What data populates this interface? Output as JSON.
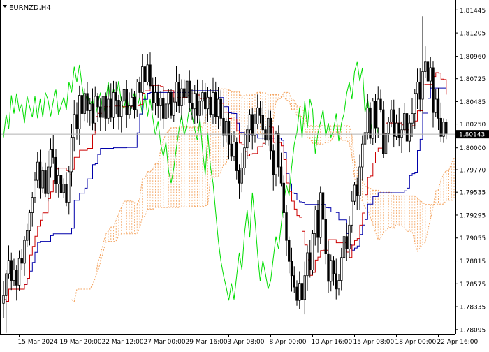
{
  "window": {
    "symbol_label": "EURNZD,H4",
    "dropdown_icon": "triangle-down-icon"
  },
  "colors": {
    "background": "#ffffff",
    "candle": "#000000",
    "tenkan": "#cc0000",
    "kijun": "#0000aa",
    "chikou": "#00dd00",
    "cloud": "#f4a460",
    "bid_line": "#b0b0b0",
    "price_tag_bg": "#000000",
    "price_tag_text": "#ffffff"
  },
  "chart_data": {
    "type": "candlestick",
    "symbol": "EURNZD",
    "timeframe": "H4",
    "ylim": [
      1.7805,
      1.8155
    ],
    "yticks": [
      "1.81445",
      "1.81205",
      "1.80960",
      "1.80725",
      "1.80485",
      "1.80250",
      "1.80000",
      "1.79770",
      "1.79535",
      "1.79295",
      "1.79055",
      "1.78815",
      "1.78575",
      "1.78335",
      "1.78095"
    ],
    "current_price": "1.80143",
    "xlabels": [
      {
        "label": "15 Mar 2024",
        "bar": 6
      },
      {
        "label": "19 Mar 20:00",
        "bar": 22
      },
      {
        "label": "22 Mar 12:00",
        "bar": 38
      },
      {
        "label": "27 Mar 00:00",
        "bar": 54
      },
      {
        "label": "29 Mar 16:00",
        "bar": 70
      },
      {
        "label": "3 Apr 08:00",
        "bar": 86
      },
      {
        "label": "8 Apr 00:00",
        "bar": 102
      },
      {
        "label": "10 Apr 16:00",
        "bar": 118
      },
      {
        "label": "15 Apr 08:00",
        "bar": 134
      },
      {
        "label": "18 Apr 00:00",
        "bar": 150
      },
      {
        "label": "22 Apr 16:00",
        "bar": 166
      }
    ],
    "close": [
      1.7845,
      1.7868,
      1.7882,
      1.7861,
      1.7872,
      1.7856,
      1.7884,
      1.7879,
      1.7903,
      1.7913,
      1.7932,
      1.7948,
      1.7966,
      1.7985,
      1.7958,
      1.7976,
      1.7952,
      1.798,
      1.7998,
      1.799,
      1.7962,
      1.7971,
      1.7953,
      1.7962,
      1.7943,
      1.7975,
      1.8011,
      1.8035,
      1.802,
      1.8055,
      1.8036,
      1.8057,
      1.8039,
      1.8046,
      1.8026,
      1.8054,
      1.8043,
      1.8032,
      1.8054,
      1.8031,
      1.8051,
      1.8032,
      1.8058,
      1.805,
      1.8033,
      1.8049,
      1.8061,
      1.8035,
      1.8044,
      1.8053,
      1.804,
      1.8069,
      1.8058,
      1.8085,
      1.8069,
      1.8087,
      1.8065,
      1.8047,
      1.8058,
      1.8044,
      1.8052,
      1.8031,
      1.8046,
      1.8058,
      1.8034,
      1.8048,
      1.8069,
      1.8044,
      1.8062,
      1.8053,
      1.807,
      1.8047,
      1.8041,
      1.8057,
      1.8034,
      1.8049,
      1.8058,
      1.8041,
      1.8053,
      1.8035,
      1.8058,
      1.8033,
      1.8051,
      1.8031,
      1.8013,
      1.8028,
      1.8004,
      1.7991,
      1.8006,
      1.7976,
      1.7963,
      1.7979,
      1.8,
      1.8019,
      1.8035,
      1.8013,
      1.8025,
      1.8042,
      1.8034,
      1.8019,
      1.8008,
      1.8031,
      1.7997,
      1.7972,
      1.8015,
      1.798,
      1.7963,
      1.7932,
      1.7903,
      1.7881,
      1.7866,
      1.7854,
      1.784,
      1.7858,
      1.7841,
      1.7866,
      1.789,
      1.7872,
      1.791,
      1.7935,
      1.7906,
      1.7953,
      1.7925,
      1.7889,
      1.786,
      1.7882,
      1.7868,
      1.7852,
      1.7861,
      1.7885,
      1.7907,
      1.7894,
      1.7919,
      1.7944,
      1.7961,
      1.795,
      1.798,
      1.8004,
      1.8016,
      1.8042,
      1.801,
      1.8049,
      1.8021,
      1.8051,
      1.804,
      1.7994,
      1.8015,
      1.8027,
      1.804,
      1.8012,
      1.8026,
      1.8011,
      1.8019,
      1.8036,
      1.8007,
      1.8026,
      1.8036,
      1.8057,
      1.8069,
      1.8051,
      1.808,
      1.809,
      1.807,
      1.8084,
      1.8037,
      1.8051,
      1.8031,
      1.8012,
      1.8027,
      1.8015
    ],
    "highs": [
      1.81,
      1.8138
    ],
    "lows": [
      1.7846,
      1.7806
    ]
  }
}
